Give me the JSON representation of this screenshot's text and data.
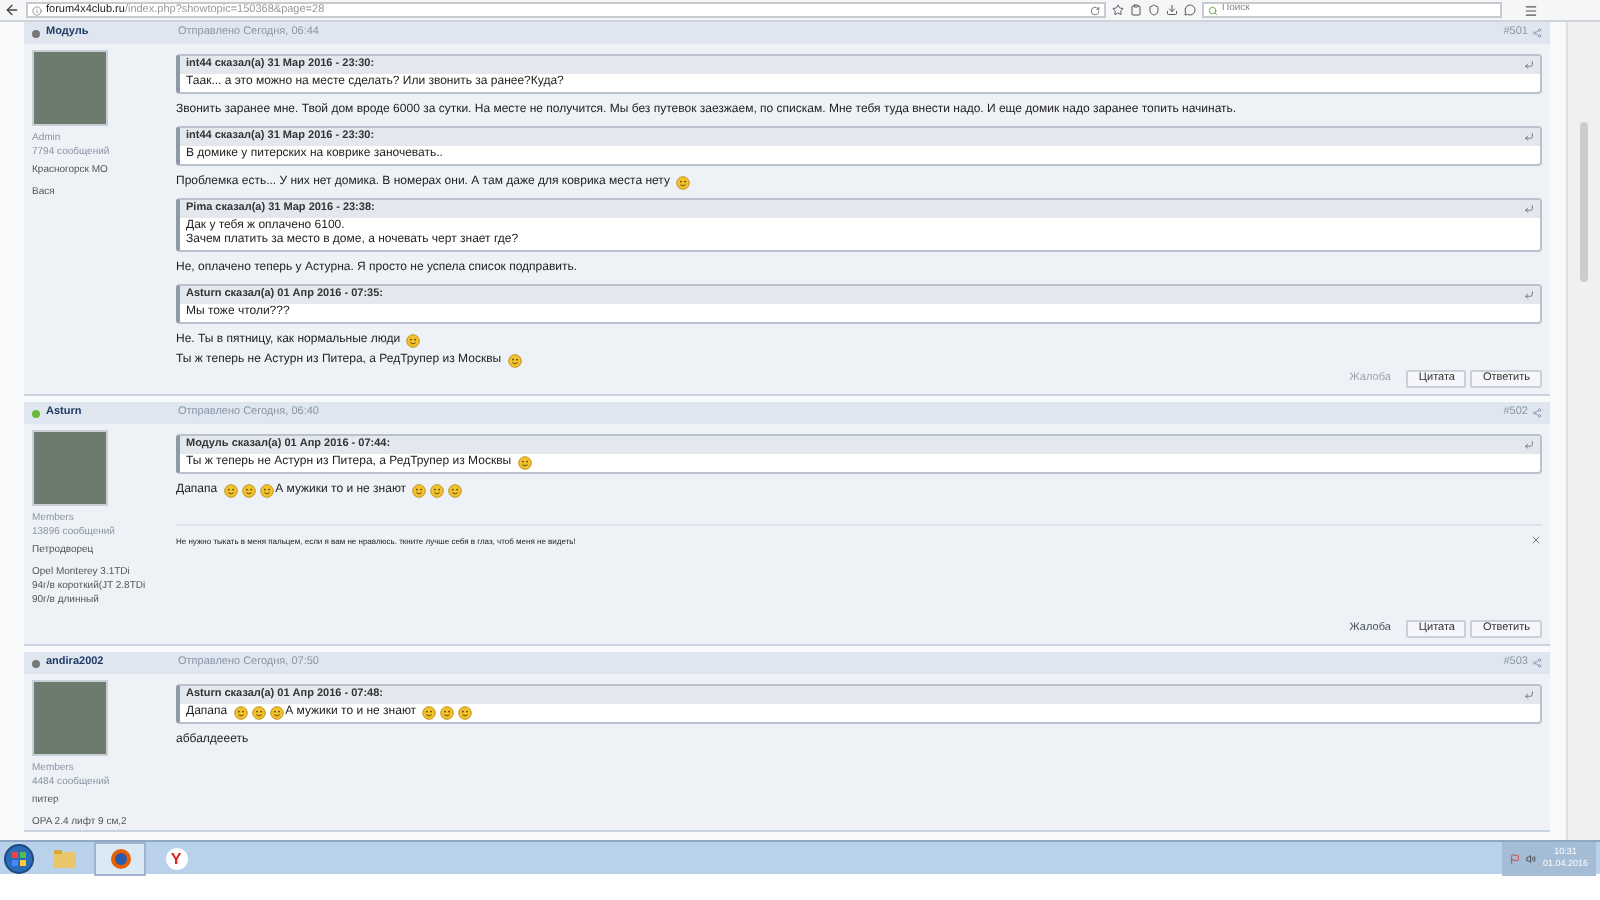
{
  "browser": {
    "url_host": "forum4x4club.ru",
    "url_path": "/index.php?showtopic=150368&page=28",
    "search_placeholder": "Поиск"
  },
  "posts": [
    {
      "author": "Модуль",
      "online": false,
      "sent": "Отправлено Сегодня, 06:44",
      "number": "#501",
      "user": {
        "group": "Admin",
        "count": "7794 сообщений",
        "city": "Красногорск МО",
        "extra": [
          "Вася"
        ]
      },
      "content": [
        {
          "kind": "quote",
          "header": "int44 сказал(а) 31 Мар 2016 - 23:30:",
          "lines": [
            [
              {
                "kind": "text",
                "text": "Таак... а это можно на месте сделать? Или звонить за ранее?Куда?"
              }
            ]
          ]
        },
        {
          "kind": "text",
          "segments": [
            {
              "kind": "text",
              "text": "Звонить заранее мне. Твой дом вроде 6000 за сутки. На месте не получится. Мы без путевок заезжаем, по спискам. Мне тебя туда внести надо. И еще домик надо заранее топить начинать."
            }
          ]
        },
        {
          "kind": "quote",
          "header": "int44 сказал(а) 31 Мар 2016 - 23:30:",
          "lines": [
            [
              {
                "kind": "text",
                "text": "В домике у питерских на коврике заночевать.."
              }
            ]
          ]
        },
        {
          "kind": "text",
          "segments": [
            {
              "kind": "text",
              "text": "Проблемка есть... У них нет домика. В номерах они. А там даже для коврика места нету"
            },
            {
              "kind": "smiley"
            }
          ]
        },
        {
          "kind": "quote",
          "header": "Pima сказал(а) 31 Мар 2016 - 23:38:",
          "lines": [
            [
              {
                "kind": "text",
                "text": "Дак у тебя ж оплачено 6100."
              }
            ],
            [
              {
                "kind": "text",
                "text": "Зачем платить за место в доме, а ночевать черт знает где?"
              }
            ]
          ]
        },
        {
          "kind": "text",
          "segments": [
            {
              "kind": "text",
              "text": "Не, оплачено теперь у Астурна. Я просто не успела список подправить."
            }
          ]
        },
        {
          "kind": "quote",
          "header": "Asturn сказал(а) 01 Апр 2016 - 07:35:",
          "lines": [
            [
              {
                "kind": "text",
                "text": "Мы тоже чтоли???"
              }
            ]
          ]
        },
        {
          "kind": "text",
          "segments": [
            {
              "kind": "text",
              "text": "Не. Ты в пятницу, как нормальные люди"
            },
            {
              "kind": "smiley"
            }
          ]
        },
        {
          "kind": "text",
          "segments": [
            {
              "kind": "text",
              "text": "Ты ж теперь не Астурн из Питера, а РедТрупер из Москвы"
            },
            {
              "kind": "smiley"
            }
          ]
        }
      ],
      "actions": [
        {
          "label": "Жалоба",
          "kind": "link",
          "disabled": true
        },
        {
          "label": "Цитата",
          "kind": "button"
        },
        {
          "label": "Ответить",
          "kind": "button"
        }
      ]
    },
    {
      "author": "Asturn",
      "online": true,
      "sent": "Отправлено Сегодня, 06:40",
      "number": "#502",
      "user": {
        "group": "Members",
        "count": "13896 сообщений",
        "city": "Петродворец",
        "extra": [
          "Opel Monterey 3.1TDi",
          "94г/в короткий(JT 2.8TDi",
          "90г/в длинный"
        ]
      },
      "content": [
        {
          "kind": "quote",
          "header": "Модуль сказал(а) 01 Апр 2016 - 07:44:",
          "lines": [
            [
              {
                "kind": "text",
                "text": "Ты ж теперь не Астурн из Питера, а РедТрупер из Москвы"
              },
              {
                "kind": "smiley"
              }
            ]
          ]
        },
        {
          "kind": "text",
          "segments": [
            {
              "kind": "text",
              "text": "Дапапа"
            },
            {
              "kind": "smiley"
            },
            {
              "kind": "smiley"
            },
            {
              "kind": "smiley"
            },
            {
              "kind": "text",
              "text": "А мужики то и не знают"
            },
            {
              "kind": "smiley"
            },
            {
              "kind": "smiley"
            },
            {
              "kind": "smiley"
            }
          ]
        }
      ],
      "signature": "Не нужно тыкать в меня пальцем, если я вам не нравлюсь. ткните лучше себя в глаз, чтоб меня не видеть!",
      "actions": [
        {
          "label": "Жалоба",
          "kind": "link",
          "disabled": false
        },
        {
          "label": "Цитата",
          "kind": "button"
        },
        {
          "label": "Ответить",
          "kind": "button"
        }
      ]
    },
    {
      "author": "andira2002",
      "online": false,
      "sent": "Отправлено Сегодня, 07:50",
      "number": "#503",
      "user": {
        "group": "Members",
        "count": "4484 сообщений",
        "city": "питер",
        "extra": [
          "OPA 2.4 лифт 9 см,2"
        ]
      },
      "content": [
        {
          "kind": "quote",
          "header": "Asturn сказал(а) 01 Апр 2016 - 07:48:",
          "lines": [
            [
              {
                "kind": "text",
                "text": "Дапапа"
              },
              {
                "kind": "smiley"
              },
              {
                "kind": "smiley"
              },
              {
                "kind": "smiley"
              },
              {
                "kind": "text",
                "text": "А мужики то и не знают"
              },
              {
                "kind": "smiley"
              },
              {
                "kind": "smiley"
              },
              {
                "kind": "smiley"
              }
            ]
          ]
        },
        {
          "kind": "text",
          "segments": [
            {
              "kind": "text",
              "text": "аббалдеееть"
            }
          ]
        }
      ]
    }
  ],
  "taskbar": {
    "apps": [
      {
        "kind": "folder",
        "selected": false
      },
      {
        "kind": "firefox",
        "selected": true
      },
      {
        "kind": "yandex",
        "glyph": "Y",
        "selected": false
      }
    ],
    "time": "10:31",
    "date": "01.04.2016"
  }
}
